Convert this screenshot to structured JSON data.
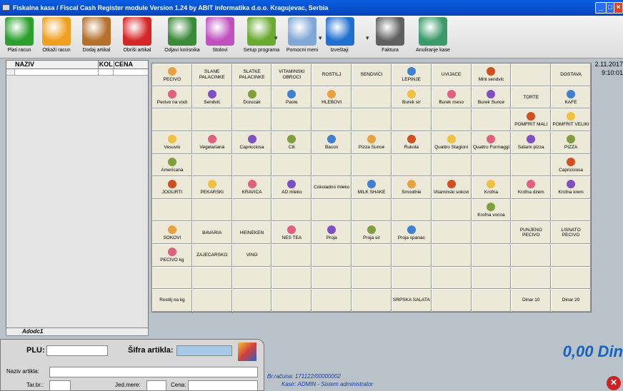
{
  "window": {
    "title": "Fiskalna kasa / Fiscal Cash Register module Version 1.24 by ABIT informatika d.o.o. Kragujevac, Serbia"
  },
  "toolbar": [
    {
      "label": "Plati racun",
      "icon": "check-icon",
      "color": "#2ca02c"
    },
    {
      "label": "Otkaži racun",
      "icon": "warning-icon",
      "color": "#f0a020"
    },
    {
      "label": "Dodaj artikal",
      "icon": "add-item-icon",
      "color": "#b5702c"
    },
    {
      "label": "Obriši artikal",
      "icon": "delete-icon",
      "color": "#d62728"
    },
    {
      "label": "Odjavi korisnika",
      "icon": "logout-icon",
      "color": "#3a8a3a"
    },
    {
      "label": "Stolovi",
      "icon": "tables-icon",
      "color": "#c050c0"
    },
    {
      "label": "Setup programa",
      "icon": "setup-icon",
      "color": "#6aaa30"
    },
    {
      "label": "Pomocni meni",
      "icon": "menu-icon",
      "color": "#7fa8d8"
    },
    {
      "label": "Izveštaji",
      "icon": "info-icon",
      "color": "#1f6fd0"
    },
    {
      "label": "Faktura",
      "icon": "printer-icon",
      "color": "#606060"
    },
    {
      "label": "Anuliranje kase",
      "icon": "globe-icon",
      "color": "#3a9a6a"
    }
  ],
  "item_list": {
    "columns": [
      "NAZIV",
      "KOL",
      "CENA"
    ],
    "navigator_label": "Adodc1"
  },
  "datetime": {
    "date": "2.11.2017",
    "time": "9:10:01"
  },
  "grid": [
    [
      "PECIVO",
      "SLANE PALACINKE",
      "SLATKE PALACINKE",
      "VITAMINSKI OBROCI",
      "ROSTILJ",
      "SENDVICI",
      "LEPINJE",
      "UVIJACE",
      "Mini sendvic",
      "",
      "DOSTAVA"
    ],
    [
      "Pecivo na vodi",
      "Sendvic",
      "Dorucak",
      "Paste",
      "HLEBOVI",
      "",
      "Burek sir",
      "Burek meso",
      "Burek Sunce",
      "TORTE",
      "KAFE"
    ],
    [
      "",
      "",
      "",
      "",
      "",
      "",
      "",
      "",
      "",
      "POMFRIT MALI",
      "POMFRIT VELIKI"
    ],
    [
      "Vesuvio",
      "Vegetariana",
      "Capricciosa",
      "Cili",
      "Bacon",
      "Pizza Sunce",
      "Rukola",
      "Quattro Stagioni",
      "Quattro Formaggi",
      "Salami pizza",
      "PIZZA"
    ],
    [
      "Americana",
      "",
      "",
      "",
      "",
      "",
      "",
      "",
      "",
      "",
      "Capricciosa"
    ],
    [
      "JOGURTI",
      "PEKARSKI",
      "KRAVICA",
      "AD mleko",
      "Cokoladno mleko",
      "MILK SHAKE",
      "Smoothie",
      "Vitaminski sokovi",
      "Krofna",
      "Krofna dzem",
      "Krofna krem"
    ],
    [
      "",
      "",
      "",
      "",
      "",
      "",
      "",
      "",
      "Krofna vocna",
      "",
      ""
    ],
    [
      "SOKOVI",
      "BAVARIA",
      "HEINEKEN",
      "NES TEA",
      "Proja",
      "Proja sir",
      "Proja spanac",
      "",
      "",
      "PUNJENO PECIVO",
      "LISNATO PECIVO"
    ],
    [
      "PECIVO kg",
      "ZAJECARSKO",
      "VINO",
      "",
      "",
      "",
      "",
      "",
      "",
      "",
      ""
    ],
    [
      "",
      "",
      "",
      "",
      "",
      "",
      "",
      "",
      "",
      "",
      ""
    ],
    [
      "Rostilj na kg",
      "",
      "",
      "",
      "",
      "",
      "SRPSKA SALATA",
      "",
      "",
      "Dinar 10",
      "Dinar 20"
    ]
  ],
  "grid_icons": [
    [
      1,
      0,
      0,
      0,
      0,
      0,
      1,
      0,
      1,
      0,
      0
    ],
    [
      1,
      1,
      1,
      1,
      1,
      0,
      1,
      1,
      1,
      0,
      1
    ],
    [
      0,
      0,
      0,
      0,
      0,
      0,
      0,
      0,
      0,
      1,
      1
    ],
    [
      1,
      1,
      1,
      1,
      1,
      1,
      1,
      1,
      1,
      1,
      1
    ],
    [
      1,
      0,
      0,
      0,
      0,
      0,
      0,
      0,
      0,
      0,
      1
    ],
    [
      1,
      1,
      1,
      1,
      0,
      1,
      1,
      1,
      1,
      1,
      1
    ],
    [
      0,
      0,
      0,
      0,
      0,
      0,
      0,
      0,
      1,
      0,
      0
    ],
    [
      1,
      0,
      0,
      1,
      1,
      1,
      1,
      0,
      0,
      0,
      0
    ],
    [
      1,
      0,
      0,
      0,
      0,
      0,
      0,
      0,
      0,
      0,
      0
    ],
    [
      0,
      0,
      0,
      0,
      0,
      0,
      0,
      0,
      0,
      0,
      0
    ],
    [
      0,
      0,
      0,
      0,
      0,
      0,
      0,
      0,
      0,
      0,
      0
    ]
  ],
  "form": {
    "plu_label": "PLU:",
    "sifra_label": "Šifra artikla:",
    "naziv_label": "Naziv artikla:",
    "tar_label": "Tar.br.:",
    "jed_label": "Jed.mere:",
    "cena_label": "Cena:"
  },
  "info": {
    "racun_label": "Br.računa:",
    "racun_value": "171122/00000002",
    "kasir_label": "Kasir:",
    "kasir_value": "ADMIN - Sistem administrator"
  },
  "total": "0,00 Din"
}
